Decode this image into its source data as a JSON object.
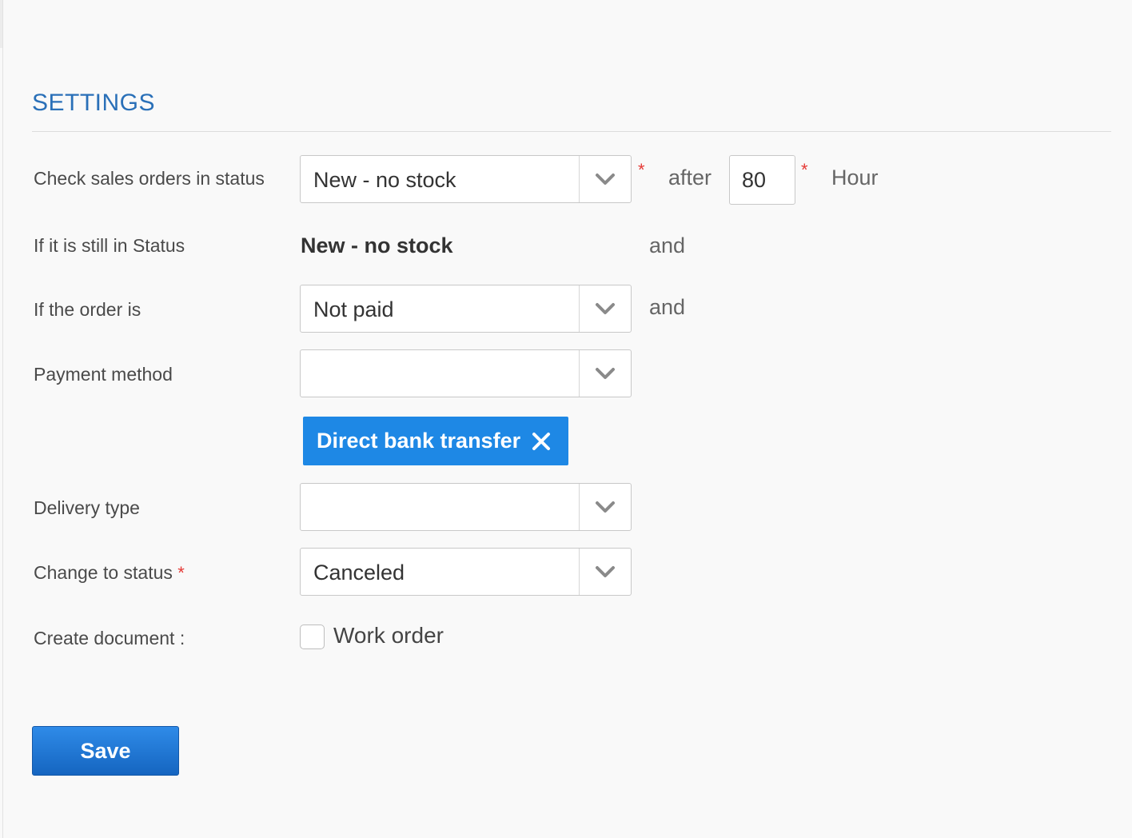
{
  "section": {
    "title": "SETTINGS"
  },
  "rows": {
    "check_status": {
      "label": "Check sales orders in status",
      "select_value": "New - no stock",
      "required_mark": "*",
      "after_label": "after",
      "hours_value": "80",
      "hours_required_mark": "*",
      "unit_label": "Hour"
    },
    "still_in_status": {
      "label": "If it is still in Status",
      "value": "New - no stock",
      "and_label": "and"
    },
    "order_is": {
      "label": "If the order is",
      "select_value": "Not paid",
      "and_label": "and"
    },
    "payment_method": {
      "label": "Payment method",
      "select_value": "",
      "selected_tag": "Direct bank transfer"
    },
    "delivery_type": {
      "label": "Delivery type",
      "select_value": ""
    },
    "change_status": {
      "label": "Change to status",
      "required_mark": "*",
      "select_value": "Canceled"
    },
    "create_document": {
      "label": "Create document :",
      "checkbox_label": "Work order",
      "checked": false
    }
  },
  "actions": {
    "save_label": "Save"
  },
  "colors": {
    "title": "#2a70b8",
    "required": "#e53935",
    "tag_background": "#1e88e5",
    "save_button": "#1e6fd9"
  }
}
